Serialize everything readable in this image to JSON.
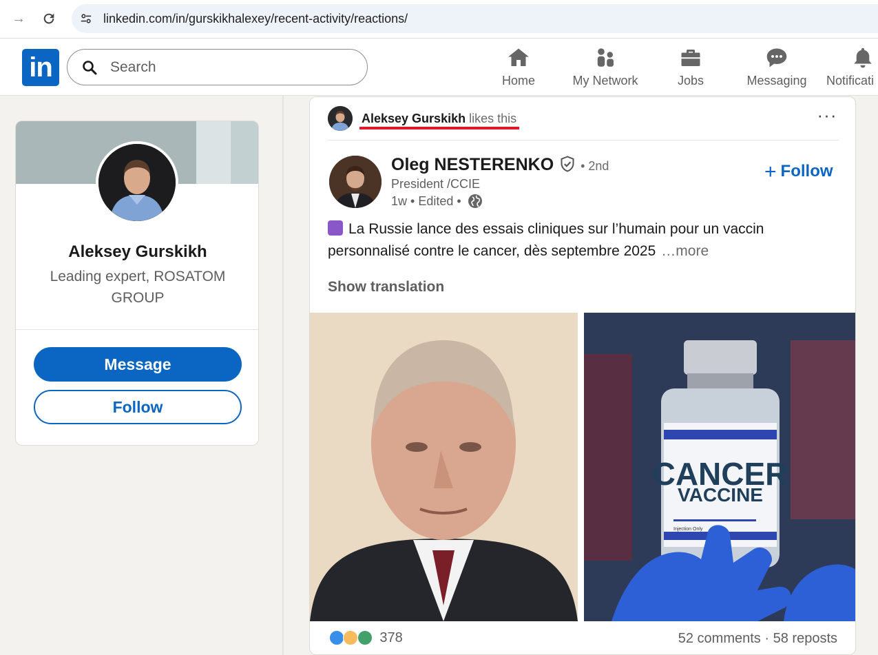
{
  "browser": {
    "url": "linkedin.com/in/gurskikhalexey/recent-activity/reactions/",
    "back_icon": "arrow-right-icon",
    "reload_icon": "reload-icon"
  },
  "header": {
    "logo": "in",
    "search_placeholder": "Search",
    "nav": [
      {
        "label": "Home",
        "icon": "home-icon"
      },
      {
        "label": "My Network",
        "icon": "network-icon"
      },
      {
        "label": "Jobs",
        "icon": "briefcase-icon"
      },
      {
        "label": "Messaging",
        "icon": "messaging-icon"
      },
      {
        "label": "Notificati",
        "icon": "bell-icon"
      }
    ]
  },
  "profile": {
    "name": "Aleksey Gurskikh",
    "headline": "Leading expert, ROSATOM GROUP",
    "message_label": "Message",
    "follow_label": "Follow"
  },
  "post": {
    "activity": {
      "actor": "Aleksey Gurskikh",
      "action": "likes this"
    },
    "author": {
      "name": "Oleg NESTERENKO",
      "degree": "• 2nd",
      "title": "President /CCIE",
      "meta": "1w • Edited •"
    },
    "follow_label": "Follow",
    "text": "La Russie lance des essais cliniques sur l’humain pour un vaccin personnalisé contre le cancer, dès septembre 2025",
    "see_more": "…more",
    "show_translation": "Show translation",
    "images": {
      "right_line1": "CANCER",
      "right_line2": "VACCINE",
      "right_small": "Injection Only"
    },
    "reaction_count": "378",
    "comments": "52 comments",
    "separator": "·",
    "reposts": "58 reposts"
  },
  "colors": {
    "linkedin_blue": "#0a66c2",
    "annotation_red": "#e0192b"
  }
}
